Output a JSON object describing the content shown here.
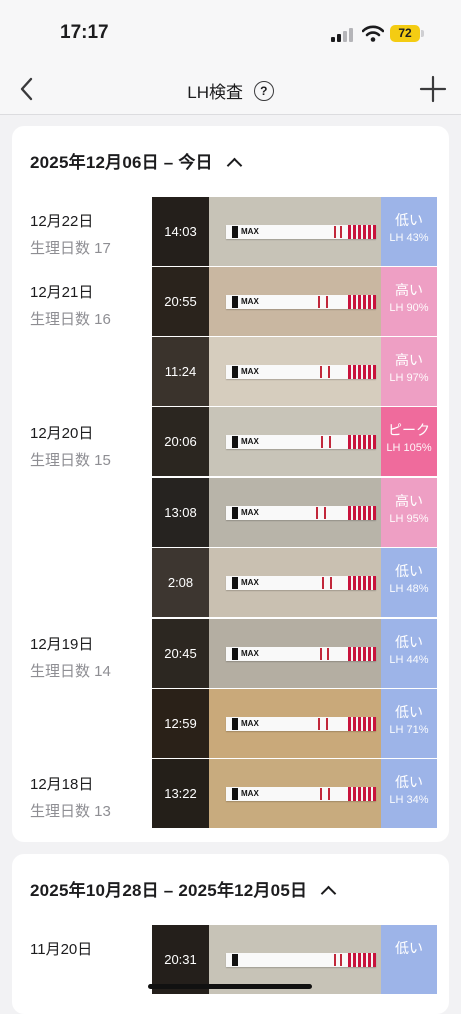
{
  "status_bar": {
    "time": "17:17",
    "battery": "72"
  },
  "nav": {
    "title": "LH検査",
    "help": "?"
  },
  "colors": {
    "low": "#9db4e8",
    "high": "#ee9fc4",
    "peak": "#ef6b9c"
  },
  "sections": [
    {
      "header": "2025年12月06日 – 今日",
      "days": [
        {
          "date": "12月22日",
          "cycle": "生理日数 17"
        },
        {
          "date": "12月21日",
          "cycle": "生理日数 16"
        },
        {
          "date": "12月20日",
          "cycle": "生理日数 15"
        },
        {
          "date": "12月19日",
          "cycle": "生理日数 14"
        },
        {
          "date": "12月18日",
          "cycle": "生理日数 13"
        }
      ],
      "tests": [
        {
          "time": "14:03",
          "result": "低い",
          "lh": "LH 43%",
          "level": "low",
          "strip_text": "MAX"
        },
        {
          "time": "20:55",
          "result": "高い",
          "lh": "LH 90%",
          "level": "high",
          "strip_text": "MAX"
        },
        {
          "time": "11:24",
          "result": "高い",
          "lh": "LH 97%",
          "level": "high",
          "strip_text": "MAX"
        },
        {
          "time": "20:06",
          "result": "ピーク",
          "lh": "LH 105%",
          "level": "peak",
          "strip_text": "MAX"
        },
        {
          "time": "13:08",
          "result": "高い",
          "lh": "LH 95%",
          "level": "high",
          "strip_text": "MAX"
        },
        {
          "time": "2:08",
          "result": "低い",
          "lh": "LH 48%",
          "level": "low",
          "strip_text": "MAX"
        },
        {
          "time": "20:45",
          "result": "低い",
          "lh": "LH 44%",
          "level": "low",
          "strip_text": "MAX"
        },
        {
          "time": "12:59",
          "result": "低い",
          "lh": "LH 71%",
          "level": "low",
          "strip_text": "MAX"
        },
        {
          "time": "13:22",
          "result": "低い",
          "lh": "LH 34%",
          "level": "low",
          "strip_text": "MAX"
        }
      ]
    },
    {
      "header": "2025年10月28日 – 2025年12月05日",
      "days": [
        {
          "date": "11月20日",
          "cycle": ""
        }
      ],
      "tests": [
        {
          "time": "20:31",
          "result": "低い",
          "lh": "",
          "level": "low",
          "strip_text": ""
        }
      ]
    }
  ]
}
